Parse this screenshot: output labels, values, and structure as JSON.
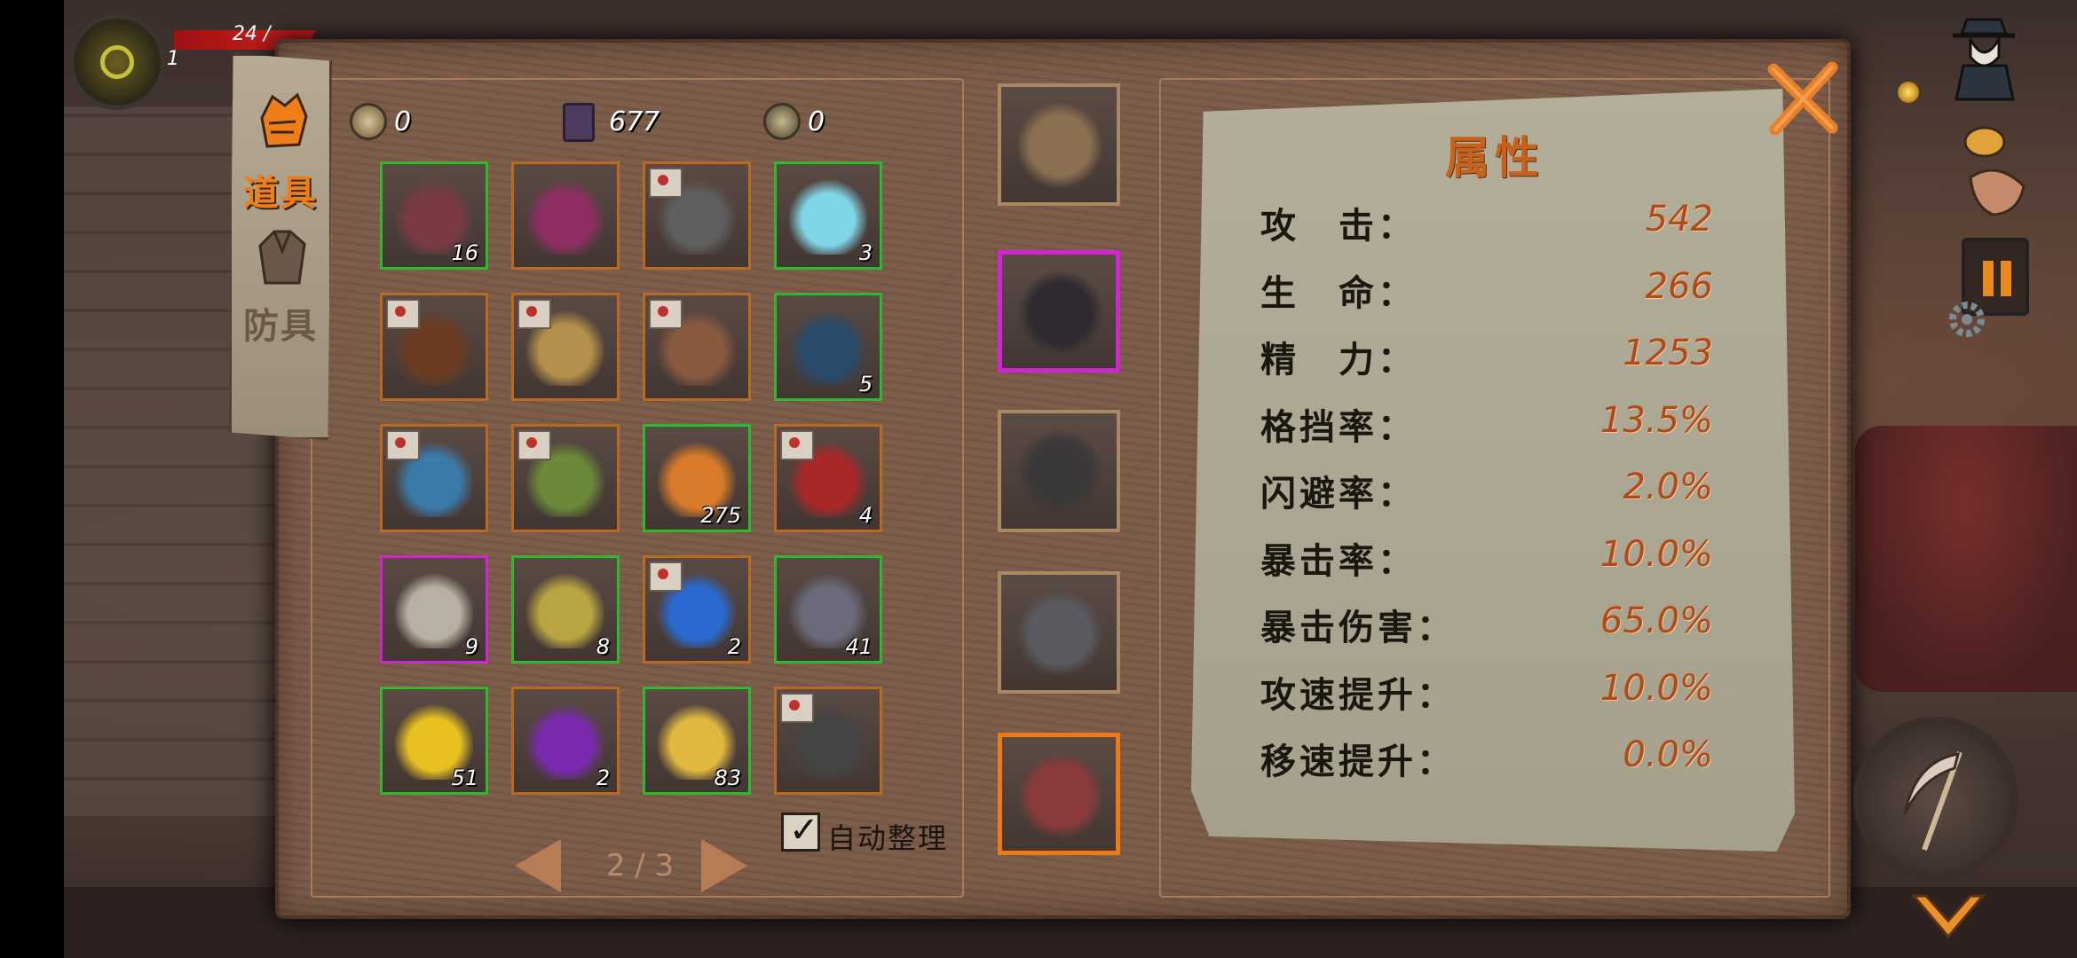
{
  "hud": {
    "level": "1",
    "hp_text": "24 /"
  },
  "tabs": [
    {
      "label": "道具",
      "active": true,
      "icon": "fist-icon"
    },
    {
      "label": "防具",
      "active": false,
      "icon": "armor-icon"
    }
  ],
  "currency": {
    "coin": "0",
    "book": "677",
    "medal": "0"
  },
  "inventory": {
    "items": [
      {
        "name": "turnip",
        "qty": "16",
        "rarity": "green",
        "selected": true
      },
      {
        "name": "cursed-tome",
        "qty": "",
        "rarity": "orange"
      },
      {
        "name": "spear-blueprint",
        "qty": "",
        "rarity": "orange"
      },
      {
        "name": "ice-crystal",
        "qty": "3",
        "rarity": "green"
      },
      {
        "name": "root-staff-blueprint",
        "qty": "",
        "rarity": "orange"
      },
      {
        "name": "axe-blueprint",
        "qty": "",
        "rarity": "orange"
      },
      {
        "name": "crossbow-blueprint",
        "qty": "",
        "rarity": "orange"
      },
      {
        "name": "blue-ore",
        "qty": "5",
        "rarity": "green"
      },
      {
        "name": "scythe-blueprint",
        "qty": "",
        "rarity": "orange"
      },
      {
        "name": "green-staff-blueprint",
        "qty": "",
        "rarity": "orange"
      },
      {
        "name": "pumpkin-candy",
        "qty": "275",
        "rarity": "green"
      },
      {
        "name": "blood-blade-blueprint",
        "qty": "4",
        "rarity": "orange"
      },
      {
        "name": "banner",
        "qty": "9",
        "rarity": "purple"
      },
      {
        "name": "gold-coin",
        "qty": "8",
        "rarity": "green"
      },
      {
        "name": "blue-claw-blueprint",
        "qty": "2",
        "rarity": "orange"
      },
      {
        "name": "key",
        "qty": "41",
        "rarity": "green"
      },
      {
        "name": "lava-stone",
        "qty": "51",
        "rarity": "green"
      },
      {
        "name": "purple-shards",
        "qty": "2",
        "rarity": "orange"
      },
      {
        "name": "gold-shard",
        "qty": "83",
        "rarity": "green"
      },
      {
        "name": "dark-sword-blueprint",
        "qty": "",
        "rarity": "orange"
      }
    ],
    "auto_sort_label": "自动整理",
    "auto_sort_checked": true,
    "page_indicator": "2 / 3"
  },
  "equipment": [
    {
      "slot": "weapon",
      "item": "staff"
    },
    {
      "slot": "cape",
      "item": "bat-cape",
      "highlight": "purple"
    },
    {
      "slot": "helmet",
      "item": "witch-hat"
    },
    {
      "slot": "armor",
      "item": "hooded-robe"
    },
    {
      "slot": "boots",
      "item": "red-boots",
      "highlight": "orange"
    }
  ],
  "attributes": {
    "title": "属性",
    "stats": [
      {
        "name": "攻　击：",
        "value": "542"
      },
      {
        "name": "生　命：",
        "value": "266"
      },
      {
        "name": "精　力：",
        "value": "1253"
      },
      {
        "name": "格挡率：",
        "value": "13.5%"
      },
      {
        "name": "闪避率：",
        "value": "2.0%"
      },
      {
        "name": "暴击率：",
        "value": "10.0%"
      },
      {
        "name": "暴击伤害：",
        "value": "65.0%"
      },
      {
        "name": "攻速提升：",
        "value": "10.0%"
      },
      {
        "name": "移速提升：",
        "value": "0.0%"
      }
    ]
  },
  "colors": {
    "rarity_green": "#2fb82f",
    "rarity_orange": "#b86a20",
    "rarity_purple": "#d025d0",
    "accent_orange": "#ef7e18",
    "stat_value": "#b04a16"
  }
}
